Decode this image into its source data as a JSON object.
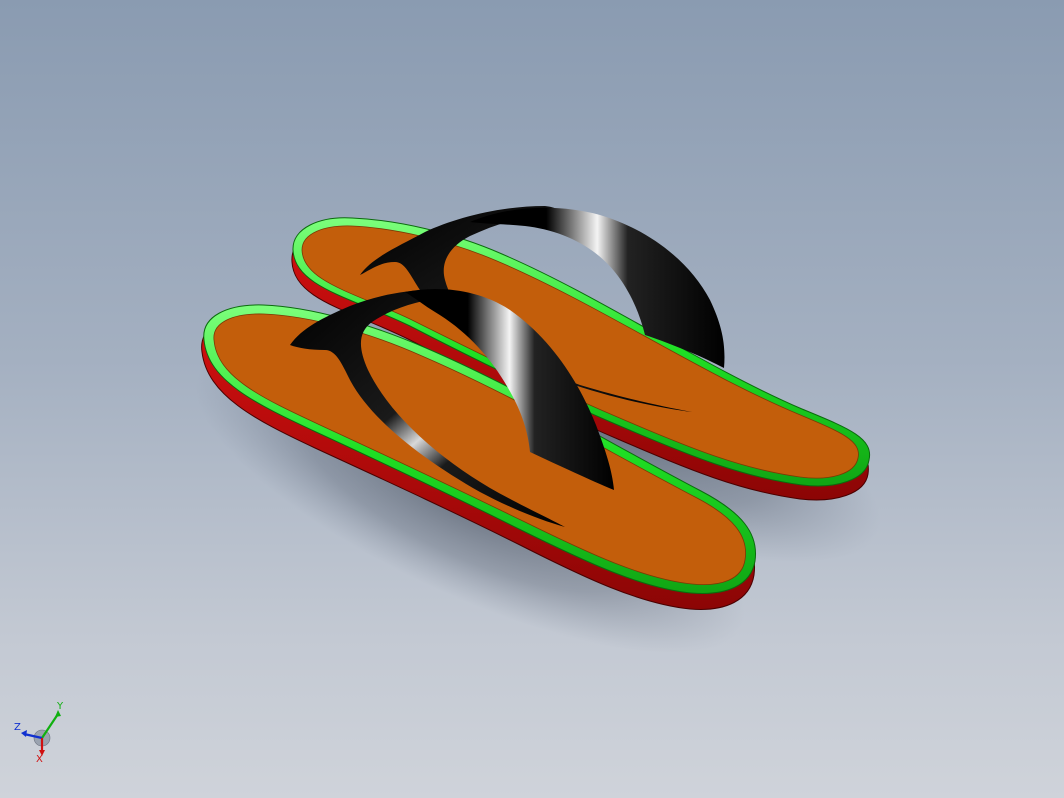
{
  "viewport": {
    "background_top": "#8a9bb1",
    "background_bottom": "#cfd3da"
  },
  "model": {
    "parts": [
      "left-flip-flop",
      "right-flip-flop"
    ],
    "colors": {
      "footbed": "#c35e0b",
      "rim": "#22e82a",
      "sole": "#c50a0a",
      "strap": "#000000"
    }
  },
  "triad": {
    "x_label": "X",
    "y_label": "Y",
    "z_label": "Z",
    "x_color": "#d01010",
    "y_color": "#10b010",
    "z_color": "#1030d0"
  }
}
